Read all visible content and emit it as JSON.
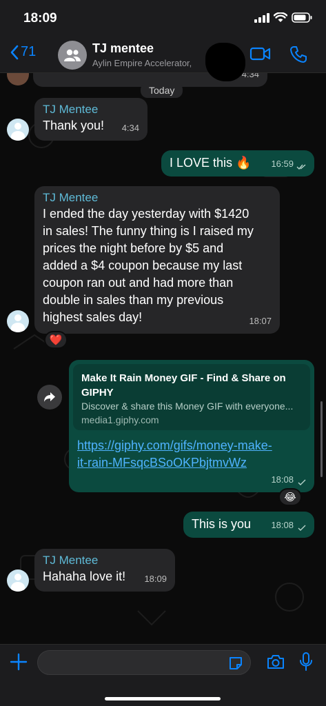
{
  "status_bar": {
    "time": "18:09"
  },
  "header": {
    "back_count": "71",
    "title": "TJ mentee",
    "subtitle": "Aylin Empire Accelerator, "
  },
  "chat": {
    "top_partial_time": "4:34",
    "date_divider": "Today",
    "messages": [
      {
        "sender": "TJ Mentee",
        "text": "Thank you!",
        "time": "4:34",
        "direction": "incoming"
      },
      {
        "text": "I LOVE this 🔥",
        "time": "16:59",
        "direction": "outgoing",
        "status": "read"
      },
      {
        "sender": "TJ Mentee",
        "lines": [
          "I ended the day yesterday with $1420",
          "in sales! The funny thing is I raised my",
          "prices the night before by $5 and",
          "added a $4 coupon because my last",
          "coupon ran out and had more than",
          "double in sales than my previous",
          "highest sales day!"
        ],
        "time": "18:07",
        "direction": "incoming",
        "reaction": "❤️"
      },
      {
        "direction": "outgoing",
        "time": "18:08",
        "status": "delivered",
        "reaction": "😂",
        "link_preview": {
          "title_lines": [
            "Make It Rain Money GIF - Find & Share on",
            "GIPHY"
          ],
          "description": "Discover & share this Money GIF with everyone...",
          "domain": "media1.giphy.com"
        },
        "url_lines": [
          "https://giphy.com/gifs/money-make-",
          "it-rain-MFsqcBSoOKPbjtmvWz"
        ]
      },
      {
        "text": "This is you",
        "time": "18:08",
        "direction": "outgoing",
        "status": "delivered"
      },
      {
        "sender": "TJ Mentee",
        "text": "Hahaha love it!",
        "time": "18:09",
        "direction": "incoming"
      }
    ]
  },
  "colors": {
    "accent": "#0a84ff",
    "incoming_bubble": "#262628",
    "outgoing_bubble": "#0b4a3f",
    "sender_name": "#5fbbd8",
    "link": "#4fb3ff"
  },
  "icons": [
    "back-chevron-icon",
    "group-avatar-icon",
    "video-call-icon",
    "phone-icon",
    "forward-icon",
    "plus-icon",
    "sticker-icon",
    "camera-icon",
    "microphone-icon"
  ]
}
